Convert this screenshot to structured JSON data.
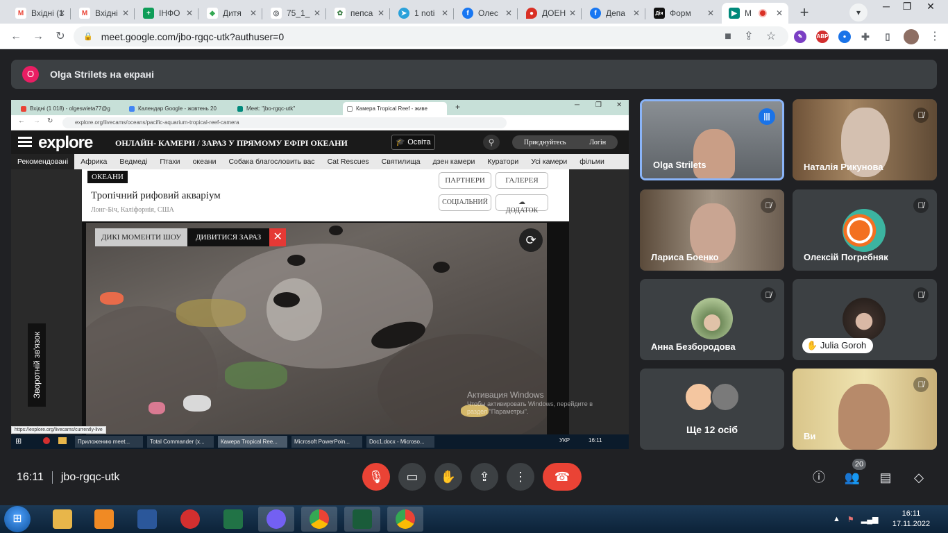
{
  "browser": {
    "tabs": [
      {
        "title": "Вхідні (1 018) - olgeswieta77@gmail.com",
        "icon": "gmail-icon",
        "color": "#ea4335",
        "glyph": "M"
      },
      {
        "title": "Вхідні",
        "icon": "gmail-icon",
        "color": "#ea4335",
        "glyph": "M"
      },
      {
        "title": "ІНФО",
        "icon": "sheets-icon",
        "color": "#0f9d58",
        "glyph": "+"
      },
      {
        "title": "Дитя",
        "icon": "shield-icon",
        "color": "#34a853",
        "glyph": "◆"
      },
      {
        "title": "75_1_",
        "icon": "globe-icon",
        "color": "#5f6368",
        "glyph": "◎"
      },
      {
        "title": "пепса",
        "icon": "site-icon",
        "color": "#3a7d44",
        "glyph": "✿"
      },
      {
        "title": "1 noti",
        "icon": "telegram-icon",
        "color": "#2aa1da",
        "glyph": "➤"
      },
      {
        "title": "Олес",
        "icon": "facebook-icon",
        "color": "#1877f2",
        "glyph": "f"
      },
      {
        "title": "ДОЕН",
        "icon": "maps-pin-icon",
        "color": "#d93025",
        "glyph": "●"
      },
      {
        "title": "Депа",
        "icon": "facebook-icon",
        "color": "#1877f2",
        "glyph": "f"
      },
      {
        "title": "Форм",
        "icon": "diia-icon",
        "color": "#111111",
        "glyph": "Дія"
      },
      {
        "title": "М",
        "icon": "meet-icon",
        "color": "#00897b",
        "glyph": "▶",
        "active": true
      }
    ],
    "url": "meet.google.com/jbo-rgqc-utk?authuser=0"
  },
  "meet": {
    "presenter_initial": "O",
    "presenter_text": "Olga Strilets на екрані",
    "time": "16:11",
    "meeting_code": "jbo-rgqc-utk",
    "people_count": "20"
  },
  "shared_screen": {
    "tabs": [
      "Вхідні (1 018) - olgeswieta77@g",
      "Календар Google - жовтень 20",
      "Meet: \"jbo-rgqc-utk\"",
      "Камера Tropical Reef - живе"
    ],
    "url": "explore.org/livecams/oceans/pacific-aquarium-tropical-reef-camera",
    "site_logo": "explore",
    "site_title": "ОНЛАЙН- КАМЕРИ / ЗАРАЗ У ПРЯМОМУ ЕФІРІ ОКЕАНИ",
    "education_btn": "Освіта",
    "join_btn": "Приєднуйтесь",
    "login_btn": "Логін",
    "nav": [
      "Рекомендовані",
      "Африка",
      "Ведмеді",
      "Птахи",
      "океани",
      "Собака благословить вас",
      "Cat Rescues",
      "Святилища",
      "дзен камери",
      "Куратори",
      "Усі камери",
      "фільми"
    ],
    "category_badge": "ОКЕАНИ",
    "cam_title": "Тропічний рифовий акваріум",
    "cam_location": "Лонг-Біч, Каліфорнія, США",
    "partners_btn": "ПАРТНЕРИ",
    "gallery_btn": "ГАЛЕРЕЯ",
    "social_btn": "СОЦІАЛЬНИЙ",
    "addon_btn": "ДОДАТОК",
    "highlights_btn": "ДИКІ МОМЕНТИ ШОУ",
    "watch_now_btn": "ДИВИТИСЯ ЗАРАЗ",
    "feedback": "Зворотній зв'язок",
    "watermark_title": "Активация Windows",
    "watermark_text": "Чтобы активировать Windows, перейдите в раздел \"Параметры\".",
    "status_url": "https://explore.org/livecams/currently-live",
    "taskbar": [
      "Приложению meet...",
      "Total Commander (x...",
      "Камера Tropical Ree...",
      "Microsoft PowerPoin...",
      "Doc1.docx - Microso..."
    ],
    "tray_lang": "УКР",
    "tray_time": "16:11"
  },
  "participants": [
    {
      "name": "Olga Strilets",
      "speaking": true
    },
    {
      "name": "Наталія Рикунова"
    },
    {
      "name": "Лариса Боенко"
    },
    {
      "name": "Олексій Погребняк"
    },
    {
      "name": "Анна Безбородова"
    },
    {
      "name": "Julia Goroh"
    },
    {
      "name": "Ще 12 осіб"
    },
    {
      "name": "Ви"
    }
  ],
  "os": {
    "clock_time": "16:11",
    "clock_date": "17.11.2022"
  }
}
